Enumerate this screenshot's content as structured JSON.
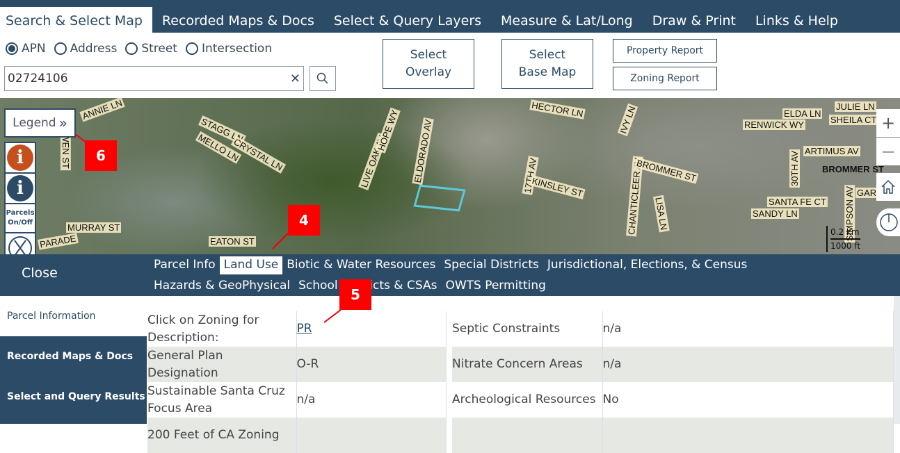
{
  "top_tabs": [
    "Search & Select Map",
    "Recorded Maps & Docs",
    "Select & Query Layers",
    "Measure & Lat/Long",
    "Draw & Print",
    "Links & Help"
  ],
  "search_types": [
    {
      "label": "APN",
      "selected": true
    },
    {
      "label": "Address",
      "selected": false
    },
    {
      "label": "Street",
      "selected": false
    },
    {
      "label": "Intersection",
      "selected": false
    }
  ],
  "search": {
    "value": "02724106",
    "clear": "✕"
  },
  "buttons": {
    "select_overlay": [
      "Select",
      "Overlay"
    ],
    "select_base_map": [
      "Select",
      "Base Map"
    ],
    "property_report": "Property Report",
    "zoning_report": "Zoning Report"
  },
  "map": {
    "legend": "Legend",
    "parcels_toggle": [
      "Parcels",
      "On/Off"
    ],
    "streets": [
      "ANNIE LN",
      "OWEN ST",
      "STAGG LN",
      "MELLO LN",
      "CRYSTAL LN",
      "LIVE OAK AV",
      "HOPE WY",
      "ELDORADO AV",
      "17TH AV",
      "HECTOR LN",
      "IVY LN",
      "CHANTICLEER AV",
      "KINSLEY ST",
      "BROMMER ST",
      "ELDA LN",
      "JULIE LN",
      "RENWICK WY",
      "SHEILA CT",
      "ARTIMUS AV",
      "30TH AV",
      "SANTA FE CT",
      "SANDY LN",
      "SIMPSON AV",
      "GARD",
      "LISA LN",
      "MURRAY ST",
      "PARADE",
      "EATON ST",
      "BROMMER ST"
    ],
    "scale_km": "0.2 km",
    "scale_ft": "1000 ft",
    "zoom_in": "+",
    "zoom_out": "—"
  },
  "annotations": [
    "6",
    "4",
    "5"
  ],
  "annotation_color": "#ff0000",
  "panel": {
    "close": "Close",
    "tabs": [
      {
        "label": "Parcel Info",
        "active": false
      },
      {
        "label": "Land Use",
        "active": true
      },
      {
        "label": "Biotic & Water Resources",
        "active": false
      },
      {
        "label": "Special Districts",
        "active": false
      },
      {
        "label": "Jurisdictional, Elections, & Census",
        "active": false
      },
      {
        "label": "Hazards & GeoPhysical",
        "active": false
      },
      {
        "label": "School Districts & CSAs",
        "active": false
      },
      {
        "label": "OWTS Permitting",
        "active": false
      }
    ],
    "side": [
      "Parcel Information",
      "Recorded Maps & Docs",
      "Select and Query Results"
    ],
    "left_rows": [
      [
        "Click on Zoning for Description:",
        "PR"
      ],
      [
        "General Plan Designation",
        "O-R"
      ],
      [
        "Sustainable Santa Cruz Focus Area",
        "n/a"
      ],
      [
        "200 Feet of CA Zoning",
        ""
      ]
    ],
    "right_rows": [
      [
        "Septic Constraints",
        "n/a"
      ],
      [
        "Nitrate Concern Areas",
        "n/a"
      ],
      [
        "Archeological Resources",
        "No"
      ],
      [
        "",
        ""
      ]
    ]
  },
  "colors": {
    "primary": "#2c4b66",
    "info_orange": "#c5501b",
    "parcel_outline": "#5ec8d8"
  }
}
